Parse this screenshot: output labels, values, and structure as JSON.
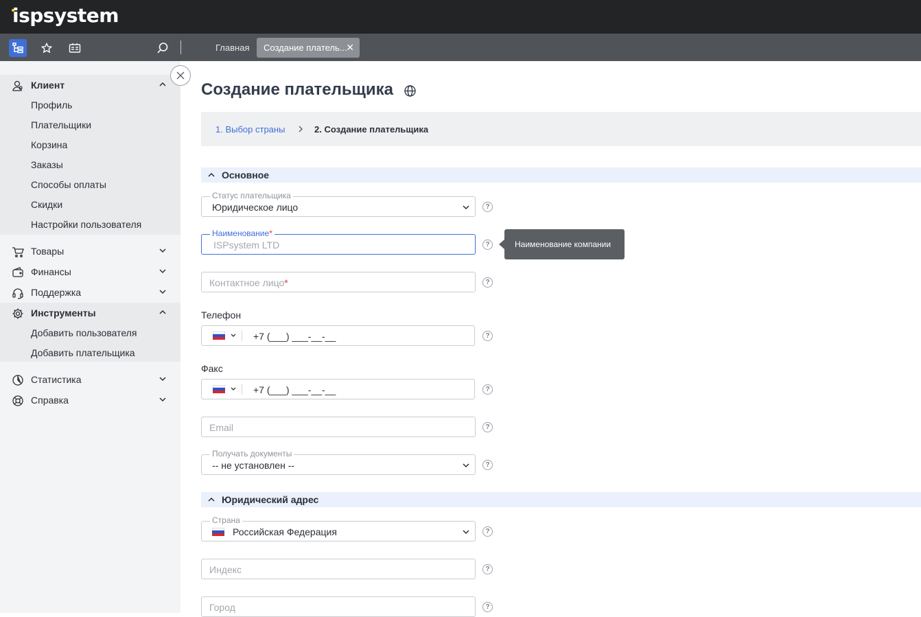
{
  "app": {
    "logo": "ispsystem"
  },
  "toolbar": {
    "tabs": [
      {
        "label": "Главная"
      },
      {
        "label": "Создание платель..."
      }
    ]
  },
  "sidebar": {
    "groups": [
      {
        "label": "Клиент",
        "icon": "client-icon",
        "open": true,
        "items": [
          "Профиль",
          "Плательщики",
          "Корзина",
          "Заказы",
          "Способы оплаты",
          "Скидки",
          "Настройки пользователя"
        ]
      },
      {
        "label": "Товары",
        "icon": "cart-icon",
        "open": false
      },
      {
        "label": "Финансы",
        "icon": "wallet-icon",
        "open": false
      },
      {
        "label": "Поддержка",
        "icon": "headset-icon",
        "open": false
      },
      {
        "label": "Инструменты",
        "icon": "gear-icon",
        "open": true,
        "items": [
          "Добавить пользователя",
          "Добавить плательщика"
        ]
      },
      {
        "label": "Статистика",
        "icon": "pie-chart-icon",
        "open": false
      },
      {
        "label": "Справка",
        "icon": "lifebuoy-icon",
        "open": false
      }
    ]
  },
  "main": {
    "title": "Создание плательщика",
    "steps": [
      "1. Выбор страны",
      "2. Создание плательщика"
    ],
    "sections": {
      "basic": "Основное",
      "legal_address": "Юридический адрес"
    },
    "fields": {
      "payer_status": {
        "label": "Статус плательщика",
        "value": "Юридическое лицо"
      },
      "name": {
        "label": "Наименование",
        "required_mark": "*",
        "placeholder": "ISPsystem LTD"
      },
      "contact": {
        "placeholder": "Контактное лицо",
        "required_mark": "*"
      },
      "phone": {
        "label": "Телефон",
        "value": "+7 (___) ___-__-__"
      },
      "fax": {
        "label": "Факс",
        "value": "+7 (___) ___-__-__"
      },
      "email": {
        "placeholder": "Email"
      },
      "receive_docs": {
        "label": "Получать документы",
        "value": "-- не установлен --"
      },
      "country": {
        "label": "Страна",
        "value": "Российская Федерация"
      },
      "index": {
        "placeholder": "Индекс"
      },
      "city": {
        "placeholder": "Город"
      }
    },
    "tooltip": "Наименование компании",
    "help_glyph": "?"
  },
  "colors": {
    "accent": "#3f6fd8",
    "topbar": "#232426",
    "toolbar": "#505358"
  }
}
